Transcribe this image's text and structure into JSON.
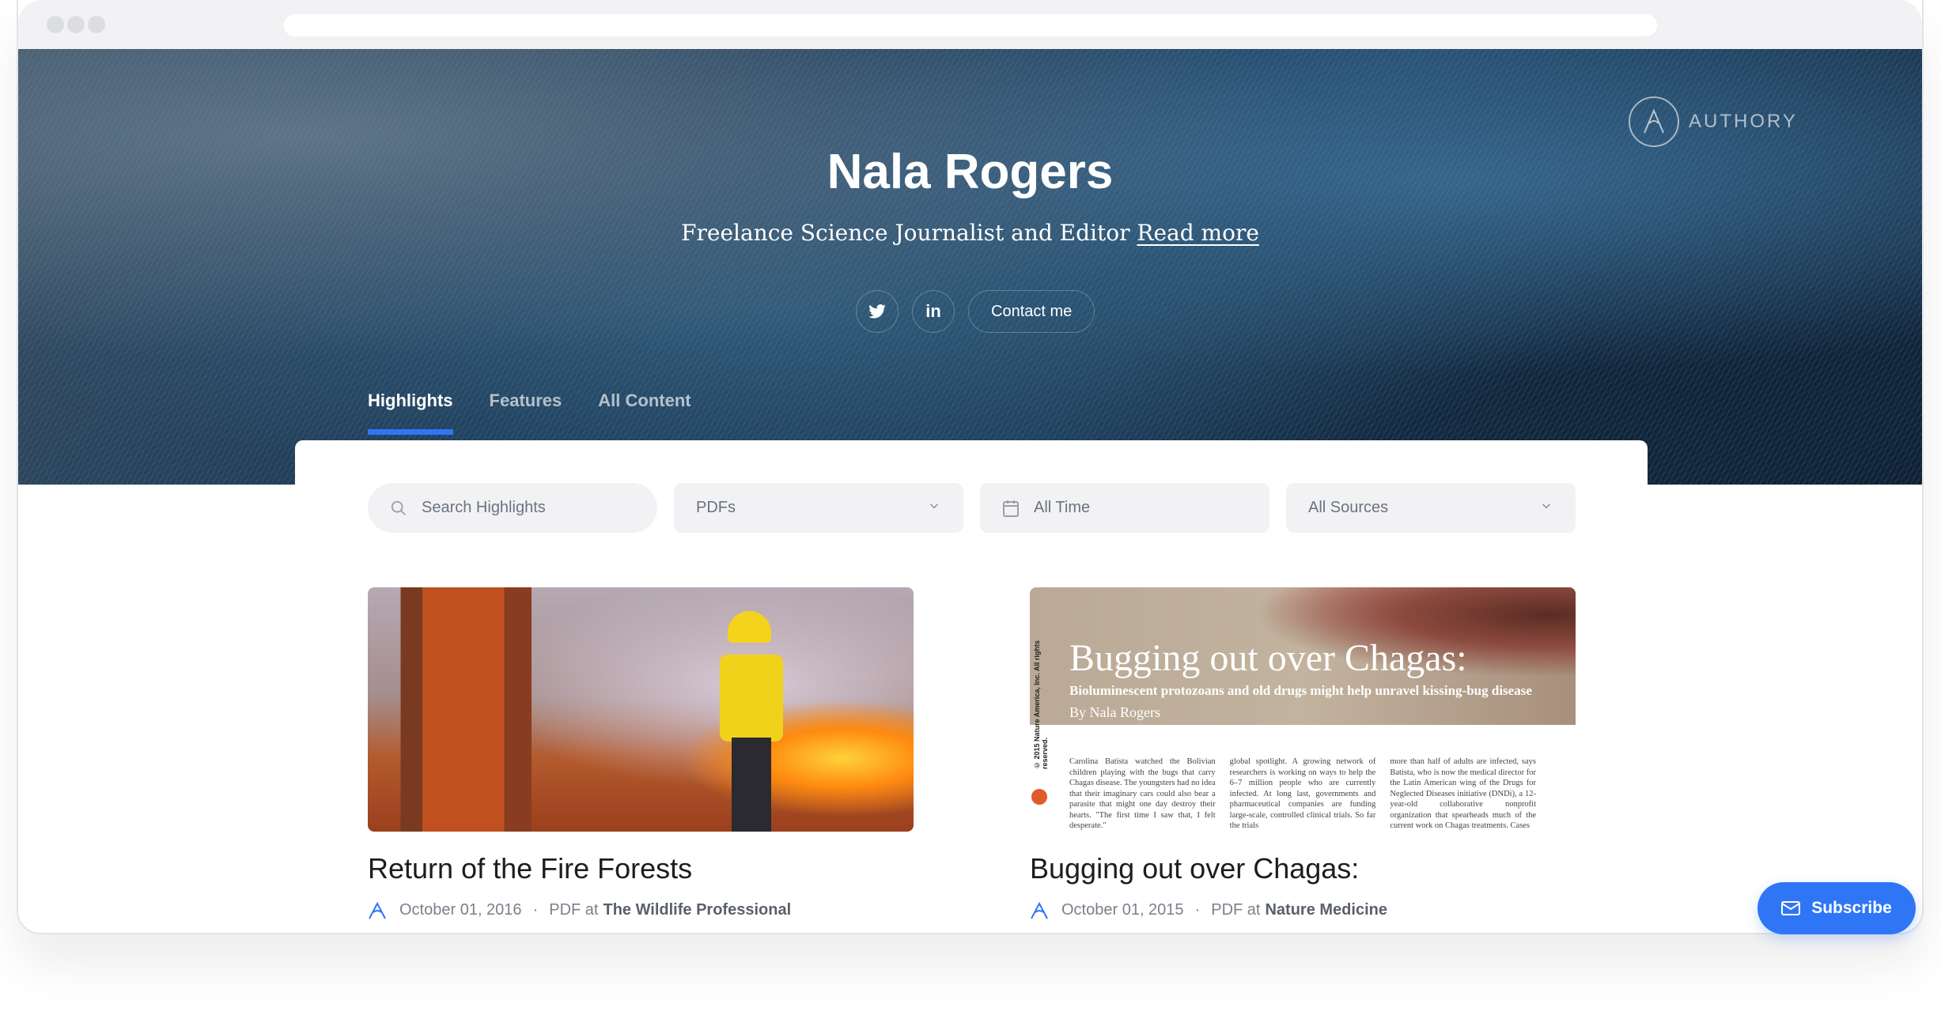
{
  "browser": {
    "window_dots": [
      "close",
      "minimize",
      "maximize"
    ]
  },
  "hero": {
    "logo_text": "AUTHORY",
    "logo_icon": "authory-logo-icon",
    "name": "Nala Rogers",
    "tagline": "Freelance Science Journalist and Editor",
    "read_more": "Read more",
    "social": [
      {
        "name": "twitter",
        "icon": "twitter-icon"
      },
      {
        "name": "linkedin",
        "icon": "linkedin-icon",
        "glyph": "in"
      }
    ],
    "contact_label": "Contact me"
  },
  "tabs": [
    {
      "label": "Highlights",
      "active": true
    },
    {
      "label": "Features",
      "active": false
    },
    {
      "label": "All Content",
      "active": false
    }
  ],
  "filters": {
    "search_placeholder": "Search Highlights",
    "type_value": "PDFs",
    "time_value": "All Time",
    "source_value": "All Sources"
  },
  "items": [
    {
      "title": "Return of the Fire Forests",
      "date": "October 01, 2016",
      "type_prefix": "PDF at",
      "source": "The Wildlife Professional",
      "thumbnail": "firefighter-in-burning-forest"
    },
    {
      "title": "Bugging out over Chagas:",
      "date": "October 01, 2015",
      "type_prefix": "PDF at",
      "source": "Nature Medicine",
      "thumbnail": {
        "headline": "Bugging out over Chagas:",
        "subhead": "Bioluminescent protozoans and old drugs might help unravel kissing-bug disease",
        "byline": "By Nala Rogers",
        "side_text": "© 2015 Nature America, Inc. All rights reserved.",
        "columns": [
          "Carolina Batista watched the Bolivian children playing with the bugs that carry Chagas disease. The youngsters had no idea that their imaginary cars could also bear a parasite that might one day destroy their hearts. \"The first time I saw that, I felt desperate.\"",
          "global spotlight. A growing network of researchers is working on ways to help the 6–7 million people who are currently infected. At long last, governments and pharmaceutical companies are funding large-scale, controlled clinical trials. So far the trials",
          "more than half of adults are infected, says Batista, who is now the medical director for the Latin American wing of the Drugs for Neglected Diseases initiative (DNDi), a 12-year-old collaborative nonprofit organization that spearheads much of the current work on Chagas treatments. Cases"
        ]
      }
    }
  ],
  "subscribe": {
    "label": "Subscribe",
    "icon": "mail-icon"
  },
  "colors": {
    "accent": "#2f76f6",
    "filter_bg": "#f2f2f4",
    "title_text": "#1c1d21",
    "meta_text": "#7b808a"
  }
}
